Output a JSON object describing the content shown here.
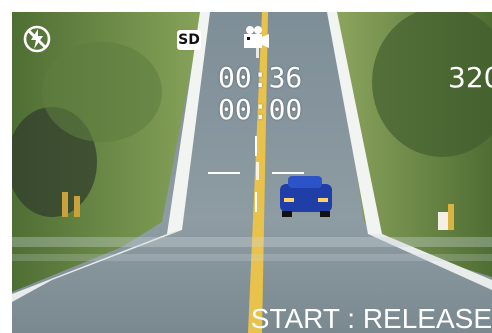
{
  "osd": {
    "flash_mode_icon": "flash-off-icon",
    "storage_badge": "SD",
    "record_mode_icon": "movie-camera-icon",
    "time_remaining": "00:36",
    "time_elapsed": "00:00",
    "resolution": "320",
    "start_hint": "START : RELEASE"
  },
  "colors": {
    "osd_text": "#ffffff",
    "road": "#7f8f99",
    "grass": "#6d8a3f",
    "sky": "#c9d5d8"
  }
}
